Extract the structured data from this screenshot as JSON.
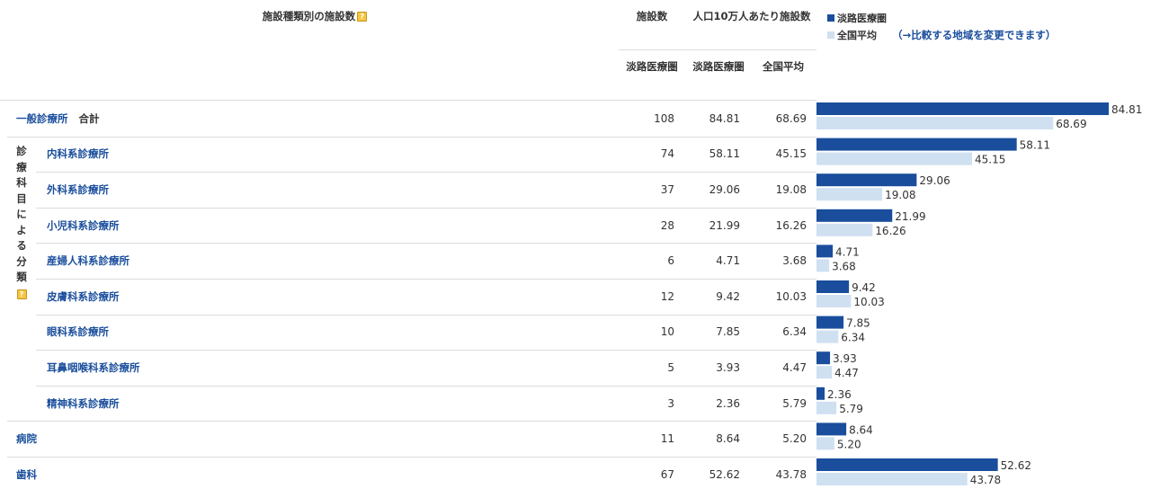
{
  "header": {
    "facility_type_title": "施設種類別の施設数",
    "help_glyph": "?",
    "count_label": "施設数",
    "per_capita_label": "人口10万人あたり施設数",
    "sub_area": "淡路医療圏",
    "sub_area_rate": "淡路医療圏",
    "sub_national": "全国平均"
  },
  "legend": {
    "area_label": "淡路医療圏",
    "national_label": "全国平均",
    "change_link": "（→比較する地域を変更できます）"
  },
  "group_label": "診療科目による分類",
  "total_suffix": "合計",
  "colors": {
    "area": "#1a4e9c",
    "national": "#cfe0f1"
  },
  "chart_data": {
    "type": "bar",
    "orientation": "horizontal",
    "categories": [
      "一般診療所",
      "内科系診療所",
      "外科系診療所",
      "小児科系診療所",
      "産婦人科系診療所",
      "皮膚科系診療所",
      "眼科系診療所",
      "耳鼻咽喉科系診療所",
      "精神科系診療所",
      "病院",
      "歯科"
    ],
    "counts": [
      "108",
      "74",
      "37",
      "28",
      "6",
      "12",
      "10",
      "5",
      "3",
      "11",
      "67"
    ],
    "series": [
      {
        "name": "淡路医療圏",
        "values": [
          84.81,
          58.11,
          29.06,
          21.99,
          4.71,
          9.42,
          7.85,
          3.93,
          2.36,
          8.64,
          52.62
        ],
        "labels": [
          "84.81",
          "58.11",
          "29.06",
          "21.99",
          "4.71",
          "9.42",
          "7.85",
          "3.93",
          "2.36",
          "8.64",
          "52.62"
        ]
      },
      {
        "name": "全国平均",
        "values": [
          68.69,
          45.15,
          19.08,
          16.26,
          3.68,
          10.03,
          6.34,
          4.47,
          5.79,
          5.2,
          43.78
        ],
        "labels": [
          "68.69",
          "45.15",
          "19.08",
          "16.26",
          "3.68",
          "10.03",
          "6.34",
          "4.47",
          "5.79",
          "5.20",
          "43.78"
        ]
      }
    ],
    "xlim": [
      0,
      84.81
    ],
    "grid": false,
    "legend_position": "top-right"
  }
}
